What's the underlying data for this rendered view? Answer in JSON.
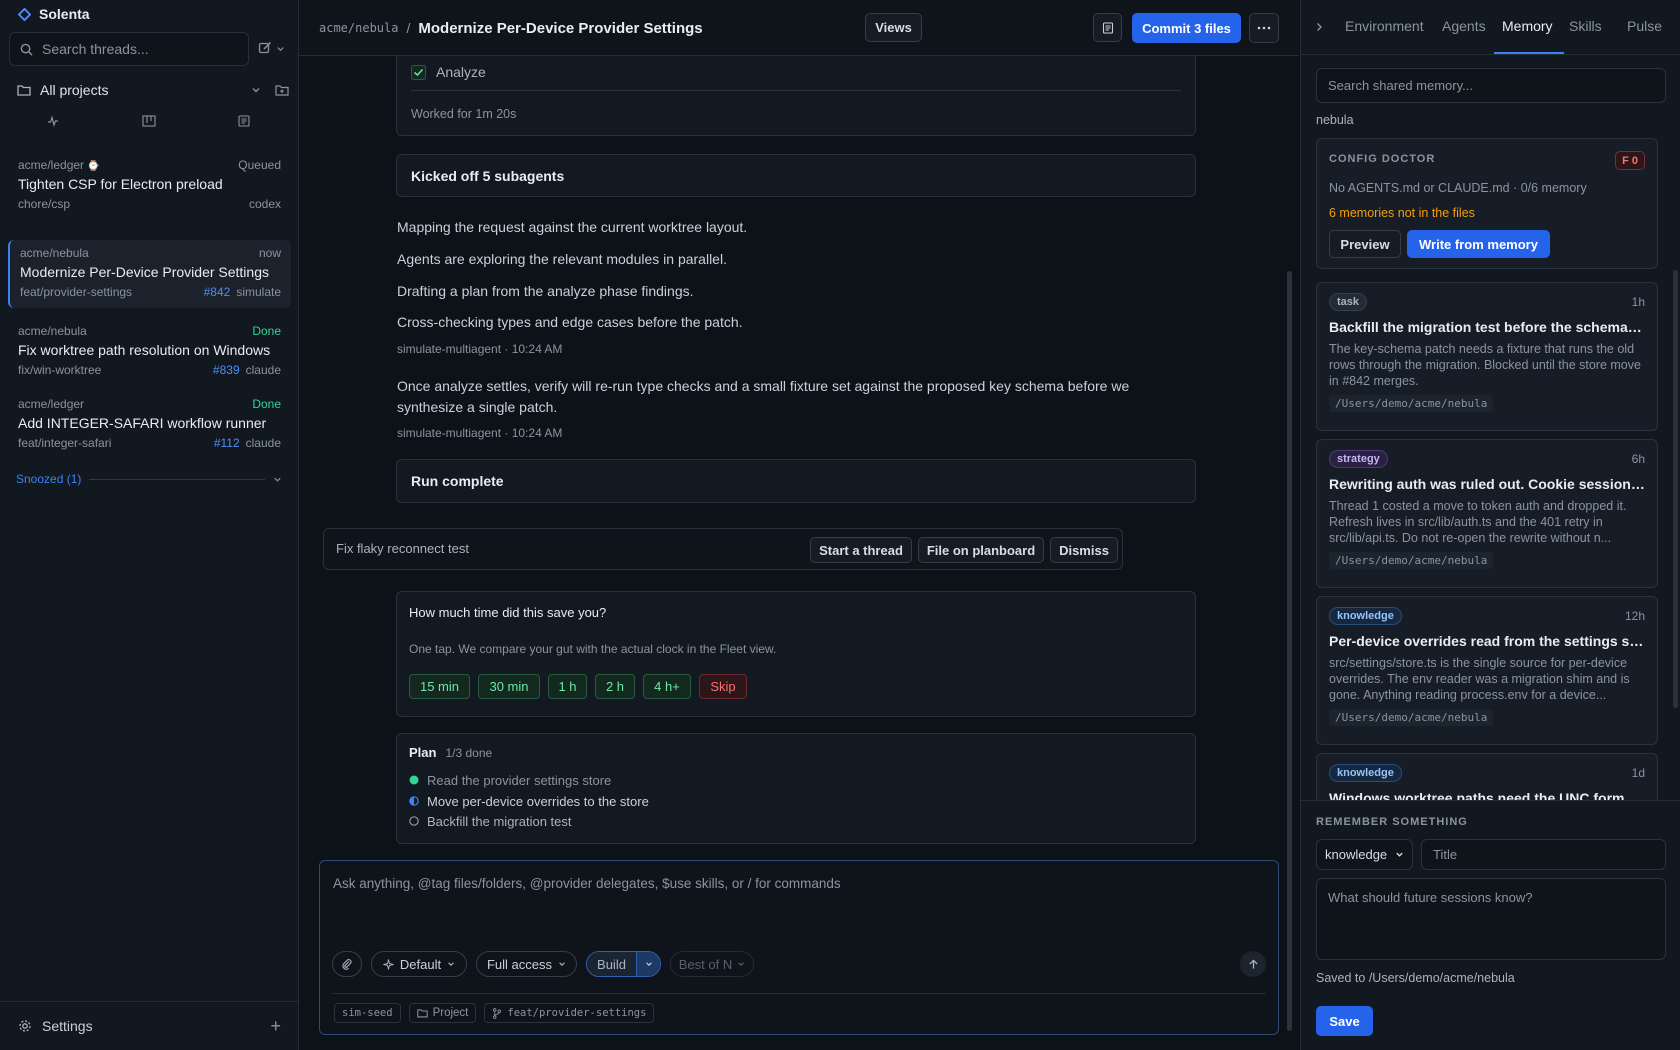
{
  "app": {
    "name": "Solenta"
  },
  "sidebar": {
    "search_placeholder": "Search threads...",
    "projects_label": "All projects",
    "threads": [
      {
        "repo": "acme/ledger",
        "status": "Queued",
        "title": "Tighten CSP for Electron preload",
        "branch": "chore/csp",
        "pr": "",
        "agent": "codex"
      },
      {
        "repo": "acme/nebula",
        "status": "now",
        "title": "Modernize Per-Device Provider Settings",
        "branch": "feat/provider-settings",
        "pr": "#842",
        "agent": "simulate"
      },
      {
        "repo": "acme/nebula",
        "status": "Done",
        "title": "Fix worktree path resolution on Windows",
        "branch": "fix/win-worktree",
        "pr": "#839",
        "agent": "claude"
      },
      {
        "repo": "acme/ledger",
        "status": "Done",
        "title": "Add INTEGER-SAFARI workflow runner",
        "branch": "feat/integer-safari",
        "pr": "#112",
        "agent": "claude"
      }
    ],
    "snoozed_label": "Snoozed (1)",
    "settings_label": "Settings"
  },
  "header": {
    "repo": "acme/nebula",
    "sep": "/",
    "title": "Modernize Per-Device Provider Settings",
    "views_label": "Views",
    "commit_label": "Commit 3 files"
  },
  "main": {
    "analyze_label": "Analyze",
    "worked_for": "Worked for 1m 20s",
    "subagents_label": "Kicked off 5 subagents",
    "lines": [
      "Mapping the request against the current worktree layout.",
      "Agents are exploring the relevant modules in parallel.",
      "Drafting a plan from the analyze phase findings.",
      "Cross-checking types and edge cases before the patch."
    ],
    "meta1": "simulate-multiagent · 10:24 AM",
    "para": "Once analyze settles, verify will re-run type checks and a small fixture set against the proposed key schema before we synthesize a single patch.",
    "meta2": "simulate-multiagent · 10:24 AM",
    "run_complete": "Run complete",
    "suggestion": {
      "text": "Fix flaky reconnect test",
      "start": "Start a thread",
      "file": "File on planboard",
      "dismiss": "Dismiss"
    },
    "survey": {
      "question": "How much time did this save you?",
      "sub": "One tap. We compare your gut with the actual clock in the Fleet view.",
      "options": [
        "15 min",
        "30 min",
        "1 h",
        "2 h",
        "4 h+"
      ],
      "skip": "Skip"
    },
    "plan": {
      "title": "Plan",
      "progress": "1/3 done",
      "items": [
        "Read the provider settings store",
        "Move per-device overrides to the store",
        "Backfill the migration test"
      ]
    },
    "composer": {
      "placeholder": "Ask anything, @tag files/folders, @provider delegates, $use skills, or / for commands",
      "mode": "Default",
      "access": "Full access",
      "build": "Build",
      "best": "Best of N",
      "seed": "sim-seed",
      "project": "Project",
      "branch": "feat/provider-settings"
    }
  },
  "right": {
    "tabs": [
      "Environment",
      "Agents",
      "Memory",
      "Skills",
      "Pulse"
    ],
    "active_tab": "Memory",
    "search_placeholder": "Search shared memory...",
    "repo": "nebula",
    "doctor": {
      "title": "CONFIG DOCTOR",
      "grade": "F 0",
      "status": "No AGENTS.md or CLAUDE.md · 0/6 memory",
      "warn": "6 memories not in the files",
      "preview": "Preview",
      "write": "Write from memory"
    },
    "memories": [
      {
        "tag": "task",
        "age": "1h",
        "title": "Backfill the migration test before the schema lands",
        "body": "The key-schema patch needs a fixture that runs the old rows through the migration. Blocked until the store move in #842 merges.",
        "path": "/Users/demo/acme/nebula"
      },
      {
        "tag": "strategy",
        "age": "6h",
        "title": "Rewriting auth was ruled out. Cookie sessions stay",
        "body": "Thread 1 costed a move to token auth and dropped it. Refresh lives in src/lib/auth.ts and the 401 retry in src/lib/api.ts. Do not re-open the rewrite without n...",
        "path": "/Users/demo/acme/nebula"
      },
      {
        "tag": "knowledge",
        "age": "12h",
        "title": "Per-device overrides read from the settings store...",
        "body": "src/settings/store.ts is the single source for per-device overrides. The env reader was a migration shim and is gone. Anything reading process.env for a device...",
        "path": "/Users/demo/acme/nebula"
      },
      {
        "tag": "knowledge",
        "age": "1d",
        "title": "Windows worktree paths need the UNC form",
        "body": "",
        "path": ""
      }
    ],
    "remember": {
      "label": "REMEMBER SOMETHING",
      "type": "knowledge",
      "title_placeholder": "Title",
      "body_placeholder": "What should future sessions know?",
      "saved_to": "Saved to /Users/demo/acme/nebula",
      "save": "Save"
    }
  }
}
